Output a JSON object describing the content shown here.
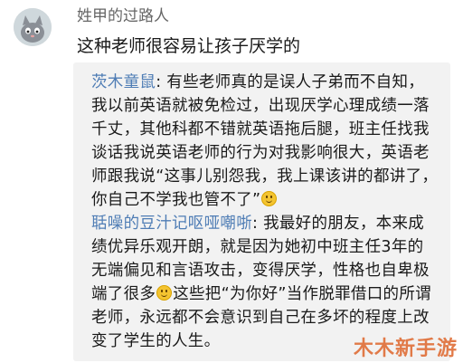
{
  "comment": {
    "username": "姓甲的过路人",
    "text": "这种老师很容易让孩子厌学的"
  },
  "replies": [
    {
      "author": "茨木童鼠",
      "separator": ":",
      "text_before_emoji": " 有些老师真的是误人子弟而不自知，我以前英语就被免检过，出现厌学心理成绩一落千丈，其他科都不错就英语拖后腿，班主任找我谈话我说英语老师的行为对我影响很大，英语老师跟我说“这事儿别怨我，我上课该讲的都讲了，你自己不学我也管不了”",
      "text_after_emoji": ""
    },
    {
      "author": "聒噪的豆汁记呕哑嘲哳",
      "separator": ":",
      "text_before_emoji": " 我最好的朋友，本来成绩优异乐观开朗，就是因为她初中班主任3年的无端偏见和言语攻击，变得厌学，性格也自卑极端了很多",
      "text_after_emoji": "这些把“为你好”当作脱罪借口的所谓老师，永远都不会意识到自己在多坏的程度上改变了学生的人生。"
    }
  ],
  "watermark": "木木新手游",
  "colors": {
    "author_link": "#4f7db5",
    "reply_background": "#f2f2f2",
    "watermark": "#e0703a",
    "username": "#666666"
  },
  "icons": {
    "emoji": "smile-emoji-icon",
    "avatar": "cartoon-cat-avatar"
  }
}
